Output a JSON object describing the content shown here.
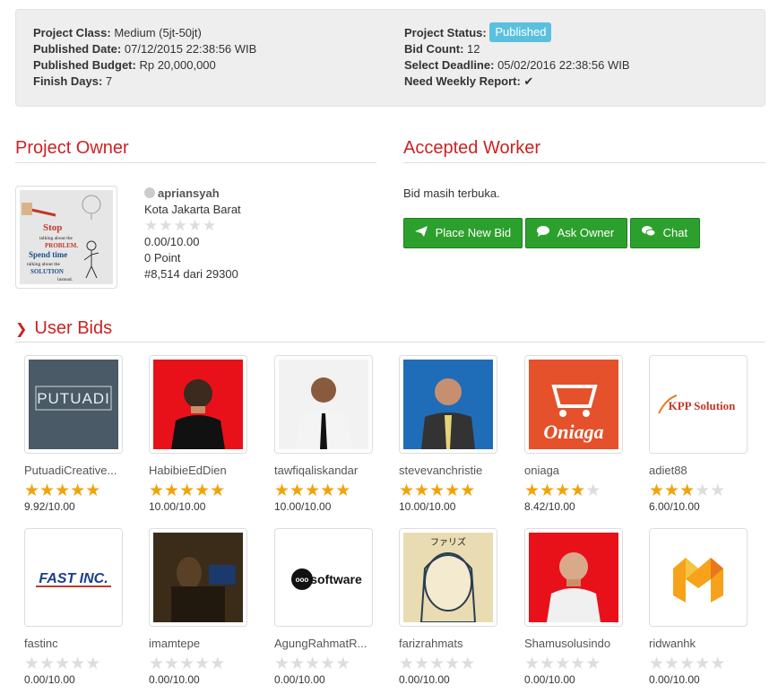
{
  "project": {
    "class_label": "Project Class:",
    "class_value": "Medium (5jt-50jt)",
    "published_date_label": "Published Date:",
    "published_date_value": "07/12/2015 22:38:56 WIB",
    "budget_label": "Published Budget:",
    "budget_value": "Rp 20,000,000",
    "finish_days_label": "Finish Days:",
    "finish_days_value": "7",
    "status_label": "Project Status:",
    "status_value": "Published",
    "bid_count_label": "Bid Count:",
    "bid_count_value": "12",
    "deadline_label": "Select Deadline:",
    "deadline_value": "05/02/2016 22:38:56 WIB",
    "weekly_report_label": "Need Weekly Report:",
    "weekly_report_value": "✔"
  },
  "owner": {
    "section_title": "Project Owner",
    "username": "apriansyah",
    "location": "Kota Jakarta Barat",
    "rating": 0,
    "score": "0.00/10.00",
    "points": "0 Point",
    "rank": "#8,514 dari 29300",
    "avatar_text": [
      "Stop",
      "talking about the",
      "PROBLEM.",
      "Spend time",
      "talking about the",
      "SOLUTION",
      "instead."
    ]
  },
  "worker": {
    "section_title": "Accepted Worker",
    "status_text": "Bid masih terbuka.",
    "buttons": {
      "place_bid": "Place New Bid",
      "ask_owner": "Ask Owner",
      "chat": "Chat"
    }
  },
  "bids": {
    "section_title": "User Bids",
    "items": [
      {
        "name": "PutuadiCreative...",
        "stars": 5,
        "score": "9.92/10.00",
        "logo": "PUTUADI",
        "bg": "#4a5a66"
      },
      {
        "name": "HabibieEdDien",
        "stars": 5,
        "score": "10.00/10.00",
        "logo": "",
        "bg": "#e8111a"
      },
      {
        "name": "tawfiqaliskandar",
        "stars": 5,
        "score": "10.00/10.00",
        "logo": "",
        "bg": "#f2f2f2"
      },
      {
        "name": "stevevanchristie",
        "stars": 5,
        "score": "10.00/10.00",
        "logo": "",
        "bg": "#1f6db8"
      },
      {
        "name": "oniaga",
        "stars": 4,
        "score": "8.42/10.00",
        "logo": "Oniaga",
        "bg": "#e4512b"
      },
      {
        "name": "adiet88",
        "stars": 3,
        "score": "6.00/10.00",
        "logo": "KPP Solution",
        "bg": "#ffffff"
      },
      {
        "name": "fastinc",
        "stars": 0,
        "score": "0.00/10.00",
        "logo": "FAST INC.",
        "bg": "#ffffff"
      },
      {
        "name": "imamtepe",
        "stars": 0,
        "score": "0.00/10.00",
        "logo": "",
        "bg": "#3a2c18"
      },
      {
        "name": "AgungRahmatR...",
        "stars": 0,
        "score": "0.00/10.00",
        "logo": "software",
        "bg": "#ffffff"
      },
      {
        "name": "farizrahmats",
        "stars": 0,
        "score": "0.00/10.00",
        "logo": "ファリズ",
        "bg": "#e9dcb2"
      },
      {
        "name": "Shamusolusindo",
        "stars": 0,
        "score": "0.00/10.00",
        "logo": "",
        "bg": "#e8111a"
      },
      {
        "name": "ridwanhk",
        "stars": 0,
        "score": "0.00/10.00",
        "logo": "M",
        "bg": "#ffffff"
      }
    ]
  },
  "colors": {
    "accent": "#cc2222",
    "button_green": "#2ca02c",
    "badge_info": "#5bc0de",
    "star_on": "#f0a30a",
    "star_off": "#dddddd"
  }
}
